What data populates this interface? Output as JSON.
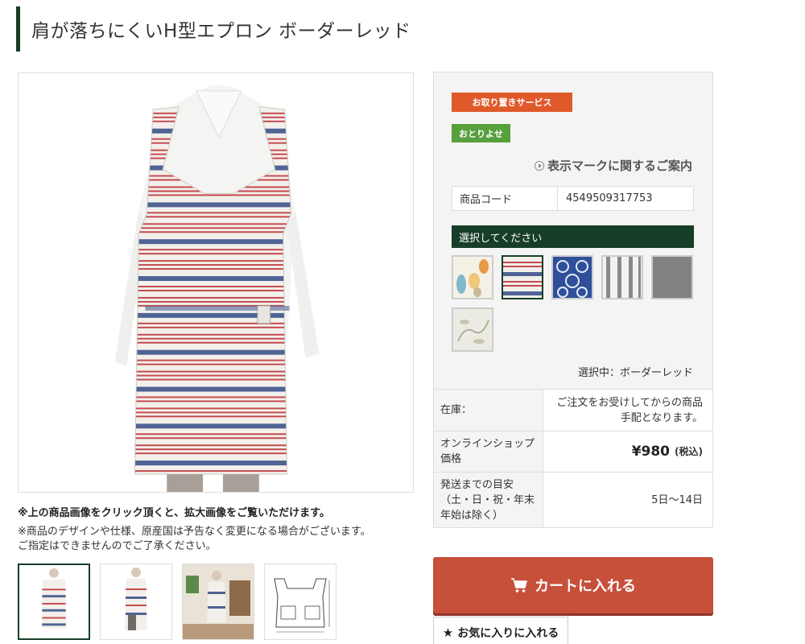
{
  "product": {
    "title": "肩が落ちにくいH型エプロン ボーダーレッド"
  },
  "notes": {
    "click_note": "※上の商品画像をクリック頂くと、拡大画像をご覧いただけます。",
    "design_note_1": "※商品のデザインや仕様、原産国は予告なく変更になる場合がございます。",
    "design_note_2": "ご指定はできませんのでご了承ください。"
  },
  "badges": {
    "service": "お取り置きサービス",
    "order": "おとりよせ"
  },
  "guide_link": "表示マークに関するご案内",
  "code": {
    "label": "商品コード",
    "value": "4549509317753"
  },
  "selection": {
    "heading": "選択してください",
    "selected_text": "選択中：ボーダーレッド"
  },
  "info": {
    "stock_label": "在庫：",
    "stock_value": "ご注文をお受けしてからの商品手配となります。",
    "price_label": "オンラインショップ価格",
    "price_value": "¥980",
    "tax_label": "(税込)",
    "shipping_label": "発送までの目安（土・日・祝・年末年始は除く）",
    "shipping_value": "5日～14日"
  },
  "buttons": {
    "cart": "カートに入れる",
    "favorite": "お気に入りに入れる"
  },
  "colors": {
    "accent_green": "#173e27",
    "badge_orange": "#e0592a",
    "badge_green": "#57a03c",
    "cart_red": "#c7503b"
  },
  "icons": {
    "cart": "cart-icon",
    "star": "star-icon",
    "arrow": "circle-arrow-icon"
  }
}
